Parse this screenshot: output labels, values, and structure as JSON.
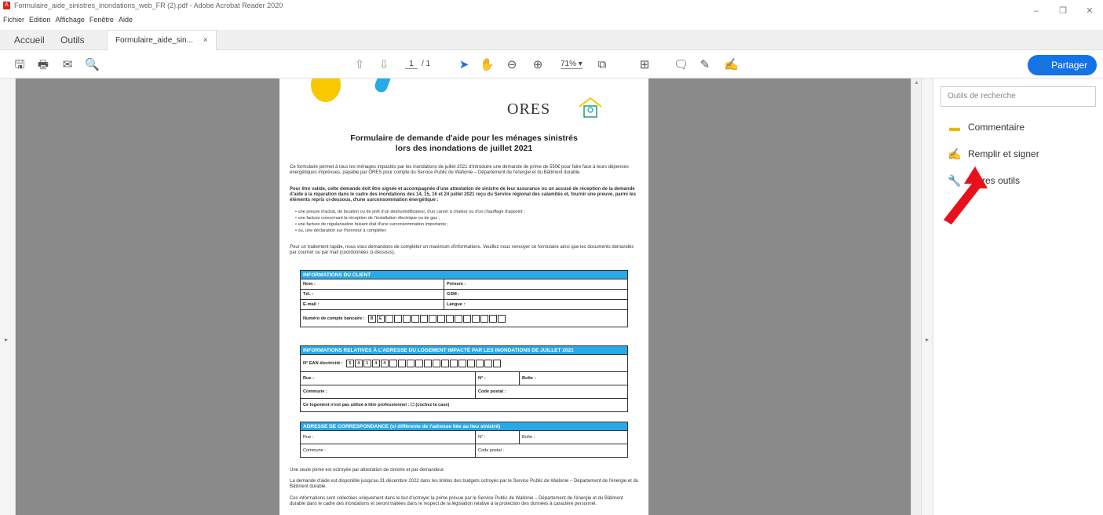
{
  "window": {
    "title": "Formulaire_aide_sinistres_inondations_web_FR (2).pdf - Adobe Acrobat Reader 2020",
    "controls": [
      "–",
      "❐",
      "✕"
    ]
  },
  "menu": [
    "Fichier",
    "Edition",
    "Affichage",
    "Fenêtre",
    "Aide"
  ],
  "tabs": {
    "home": "Accueil",
    "tools": "Outils",
    "document": "Formulaire_aide_sin...",
    "close": "×"
  },
  "toolbar": {
    "page_current": "1",
    "page_total": "/ 1",
    "zoom": "71%",
    "share_label": "Partager",
    "accent_color": "#1473e6"
  },
  "right_panel": {
    "search_placeholder": "Outils de recherche",
    "tools": [
      {
        "label": "Commentaire",
        "icon": "comment-icon"
      },
      {
        "label": "Remplir et signer",
        "icon": "fill-sign-icon"
      },
      {
        "label": "Autres outils",
        "icon": "wrench-icon"
      }
    ]
  },
  "document": {
    "brand": "ORES",
    "title_line1": "Formulaire de demande d'aide pour les ménages sinistrés",
    "title_line2": "lors des inondations de juillet 2021",
    "para1": "Ce formulaire permet à tous les ménages impactés par les inondations de juillet 2021 d'introduire une demande de prime de 550€ pour faire face à leurs dépenses énergétiques imprévues, payable par ORES pour compte du Service Public de Wallonie – Département de l'énergie et du Bâtiment durable.",
    "para2": "Pour être valide, cette demande doit être signée et accompagnée d'une attestation de sinistre de leur assurance ou un accusé de réception de la demande d'aide à la réparation dans le cadre des inondations des 14, 15, 16 et 24 juillet 2021 reçu du Service régional des calamités et, fournir une preuve, parmi les éléments repris ci-dessous, d'une surconsommation énergétique :",
    "bullets": [
      "• une preuve d'achat, de location ou de prêt d'un déshumidificateur, d'un canon à chaleur ou d'un chauffage d'appoint ;",
      "• une facture concernant la réception de l'installation électrique ou de gaz ;",
      "• une facture de régularisation faisant état d'une surconsommation importante ;",
      "• ou, une déclaration sur l'honneur à compléter."
    ],
    "para3": "Pour un traitement rapide, nous vous demandons de compléter un maximum d'informations. Veuillez nous renvoyer ce formulaire ainsi que les documents demandés par courrier ou par mail (coordonnées ci-dessous).",
    "section1": {
      "header": "INFORMATIONS DU CLIENT",
      "nom": "Nom :",
      "prenom": "Prénom :",
      "tel": "Tél. :",
      "gsm": "GSM :",
      "email": "E-mail :",
      "langue": "Langue :",
      "compte": "Numéro de compte bancaire :",
      "compte_prefix": [
        "B",
        "E"
      ]
    },
    "section2": {
      "header": "INFORMATIONS RELATIVES À L'ADRESSE DU LOGEMENT IMPACTÉ PAR LES INONDATIONS DE JUILLET 2021",
      "ean": "N° EAN électricité :",
      "ean_prefix": [
        "5",
        "4",
        "1",
        "4",
        "4"
      ],
      "rue": "Rue :",
      "num": "N° :",
      "boite": "Boîte :",
      "commune": "Commune :",
      "code_postal": "Code postal :",
      "pro": "Ce logement n'est pas utilisé à titre professionnel : ☐ (cochez la case)"
    },
    "section3": {
      "header": "ADRESSE DE CORRESPONDANCE (si différente de l'adresse liée au lieu sinistré)",
      "rue": "Rue :",
      "num": "N° :",
      "boite": "Boîte :",
      "commune": "Commune :",
      "code_postal": "Code postal :"
    },
    "foot1": "Une seule prime est octroyée par attestation de sinistre et par demandeur.",
    "foot2": "La demande d'aide est disponible jusqu'au 31 décembre 2022 dans les limites des budgets octroyés par le Service Public de Wallonie – Département de l'énergie et du Bâtiment durable.",
    "foot3": "Ces informations sont collectées uniquement dans le but d'octroyer la prime prévue par le Service Public de Wallonie – Département de l'énergie et du Bâtiment durable dans le cadre des inondations et seront traitées dans le respect de la législation relative à la protection des données à caractère personnel."
  }
}
